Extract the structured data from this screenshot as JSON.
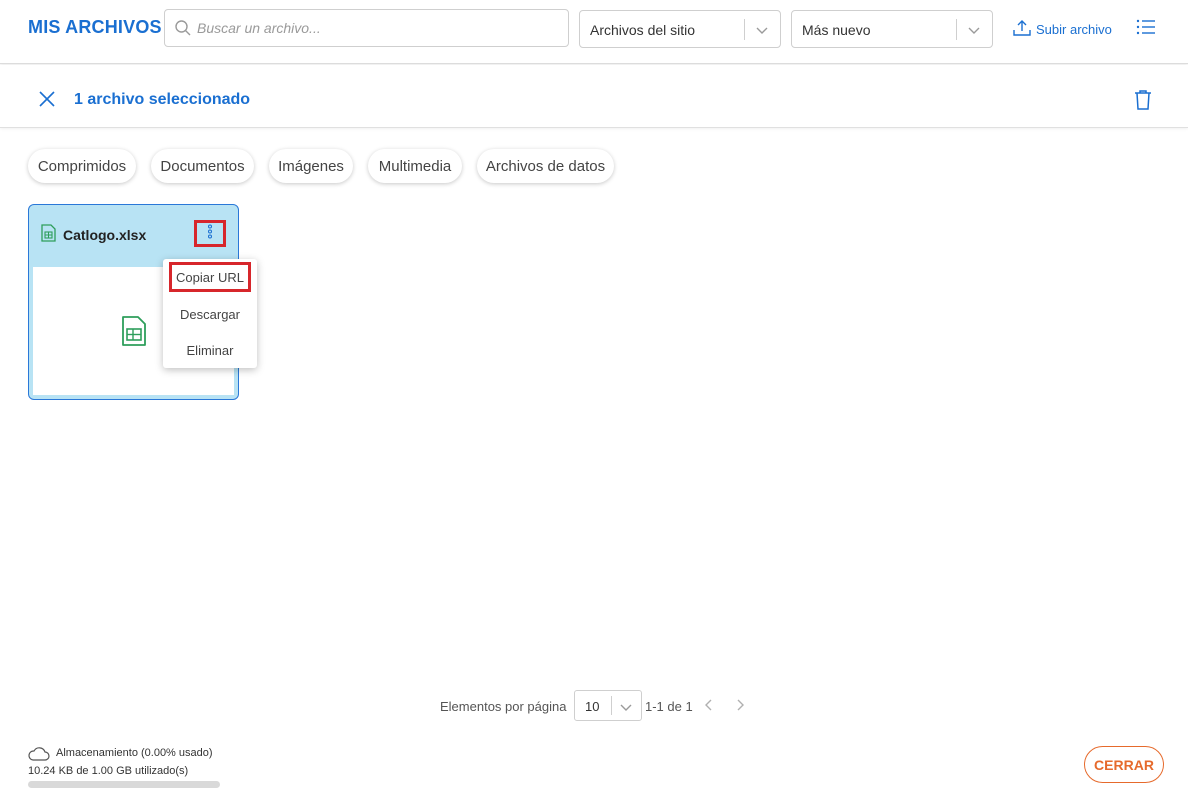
{
  "header": {
    "title": "MIS ARCHIVOS",
    "search_placeholder": "Buscar un archivo...",
    "scope_select": "Archivos del sitio",
    "sort_select": "Más nuevo",
    "upload_label": "Subir archivo"
  },
  "selection": {
    "label": "1 archivo seleccionado"
  },
  "filters": [
    {
      "label": "Comprimidos"
    },
    {
      "label": "Documentos"
    },
    {
      "label": "Imágenes"
    },
    {
      "label": "Multimedia"
    },
    {
      "label": "Archivos de datos"
    }
  ],
  "file": {
    "name": "Catlogo.xlsx"
  },
  "menu": {
    "items": [
      {
        "label": "Copiar URL"
      },
      {
        "label": "Descargar"
      },
      {
        "label": "Eliminar"
      }
    ]
  },
  "pagination": {
    "label": "Elementos por página",
    "page_size": "10",
    "range": "1-1 de 1"
  },
  "storage": {
    "title": "Almacenamiento (0.00% usado)",
    "used": "10.24 KB de 1.00 GB utilizado(s)",
    "used_fraction": 0.0
  },
  "footer": {
    "close_label": "CERRAR"
  },
  "colors": {
    "brand": "#1a6fd1",
    "card_selected_bg": "#b8e3f4",
    "file_icon_green": "#2e9e5b",
    "highlight_red": "#d7262b",
    "close_orange": "#e66a2c"
  },
  "icons": [
    "search-icon",
    "chevron-down-icon",
    "upload-icon",
    "list-view-icon",
    "close-icon",
    "trash-icon",
    "spreadsheet-file-icon",
    "kebab-menu-icon",
    "chevron-left-icon",
    "chevron-right-icon",
    "cloud-icon"
  ]
}
